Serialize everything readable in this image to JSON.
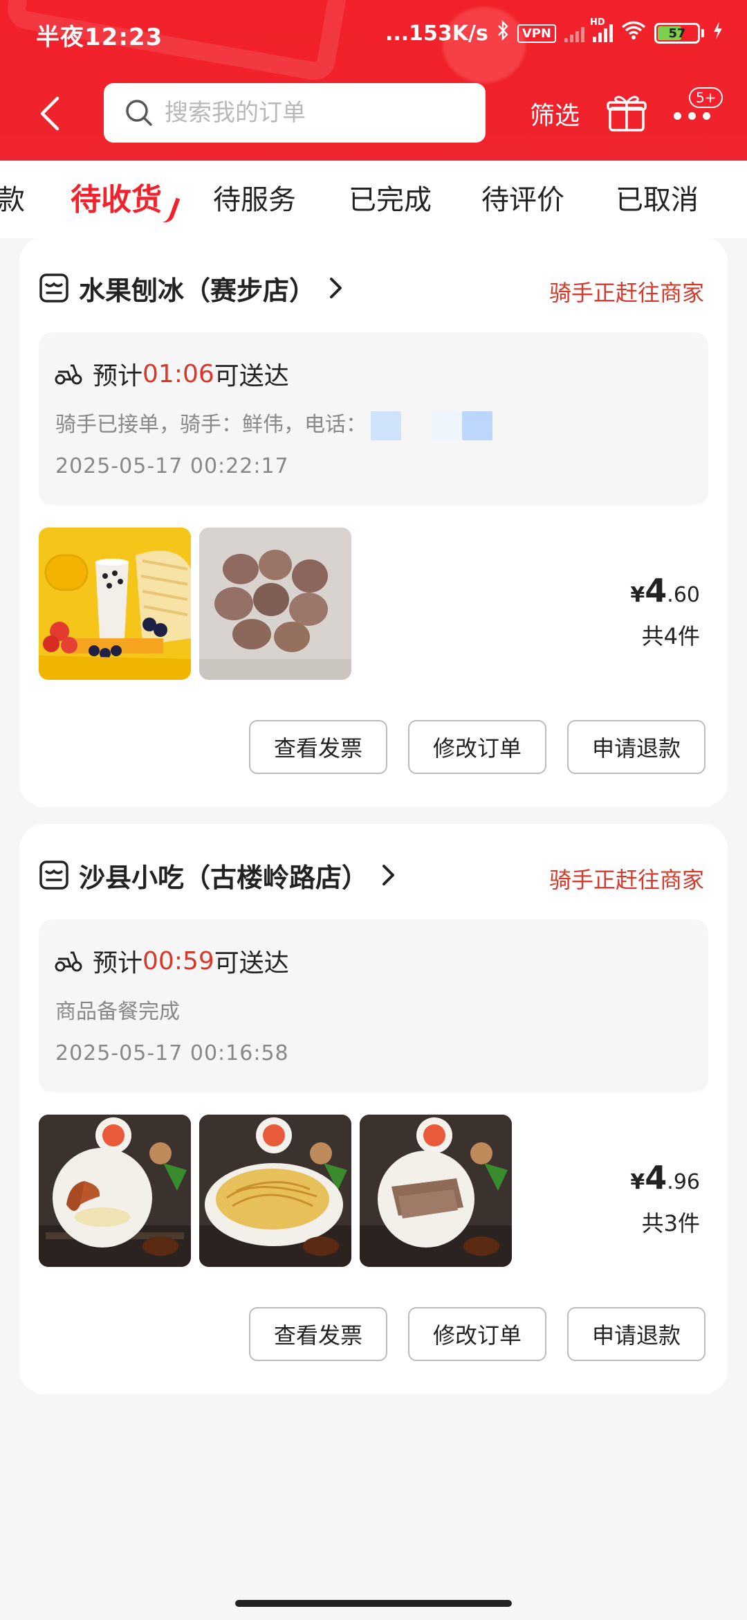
{
  "status_bar": {
    "time": "半夜12:23",
    "net_speed": "...153K/s",
    "vpn": "VPN",
    "hd": "HD",
    "battery": "57"
  },
  "header": {
    "search_placeholder": "搜索我的订单",
    "filter_label": "筛选",
    "more_badge": "5+",
    "colors": {
      "brand_red": "#f2212b",
      "status_red": "#d6392b"
    },
    "icons": [
      "back-icon",
      "search-icon",
      "gift-icon",
      "more-icon"
    ]
  },
  "tabs": [
    {
      "label": "款",
      "active": false
    },
    {
      "label": "待收货",
      "active": true
    },
    {
      "label": "待服务",
      "active": false
    },
    {
      "label": "已完成",
      "active": false
    },
    {
      "label": "待评价",
      "active": false
    },
    {
      "label": "已取消",
      "active": false
    }
  ],
  "orders": [
    {
      "shop_name": "水果刨冰（赛步店）",
      "status": "骑手正赶往商家",
      "eta_prefix": "预计",
      "eta_time": "01:06",
      "eta_suffix": "可送达",
      "note": "骑手已接单，骑手：鲜伟，电话：",
      "timestamp": "2025-05-17 00:22:17",
      "price_symbol": "¥",
      "price_int": "4",
      "price_dec": ".60",
      "item_count": "共4件",
      "buttons": [
        "查看发票",
        "修改订单",
        "申请退款"
      ]
    },
    {
      "shop_name": "沙县小吃（古楼岭路店）",
      "status": "骑手正赶往商家",
      "eta_prefix": "预计",
      "eta_time": "00:59",
      "eta_suffix": "可送达",
      "note": "商品备餐完成",
      "timestamp": "2025-05-17 00:16:58",
      "price_symbol": "¥",
      "price_int": "4",
      "price_dec": ".96",
      "item_count": "共3件",
      "buttons": [
        "查看发票",
        "修改订单",
        "申请退款"
      ]
    }
  ]
}
